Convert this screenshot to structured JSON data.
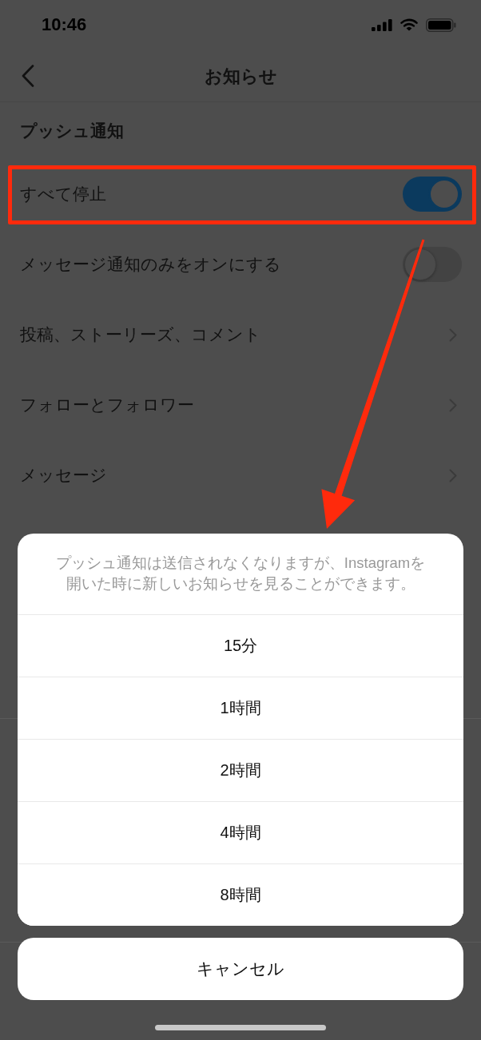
{
  "status_bar": {
    "time": "10:46"
  },
  "nav": {
    "title": "お知らせ"
  },
  "section": {
    "title": "プッシュ通知"
  },
  "rows": [
    {
      "kind": "toggle",
      "label": "すべて停止",
      "on": true,
      "highlighted": true
    },
    {
      "kind": "toggle",
      "label": "メッセージ通知のみをオンにする",
      "on": false,
      "highlighted": false
    },
    {
      "kind": "link",
      "label": "投稿、ストーリーズ、コメント",
      "highlighted": false
    },
    {
      "kind": "link",
      "label": "フォローとフォロワー",
      "highlighted": false
    },
    {
      "kind": "link",
      "label": "メッセージ",
      "highlighted": false
    }
  ],
  "annotation_arrow": true,
  "action_sheet": {
    "message": "プッシュ通知は送信されなくなりますが、Instagramを開いた時に新しいお知らせを見ることができます。",
    "options": [
      "15分",
      "1時間",
      "2時間",
      "4時間",
      "8時間"
    ],
    "cancel": "キャンセル"
  }
}
